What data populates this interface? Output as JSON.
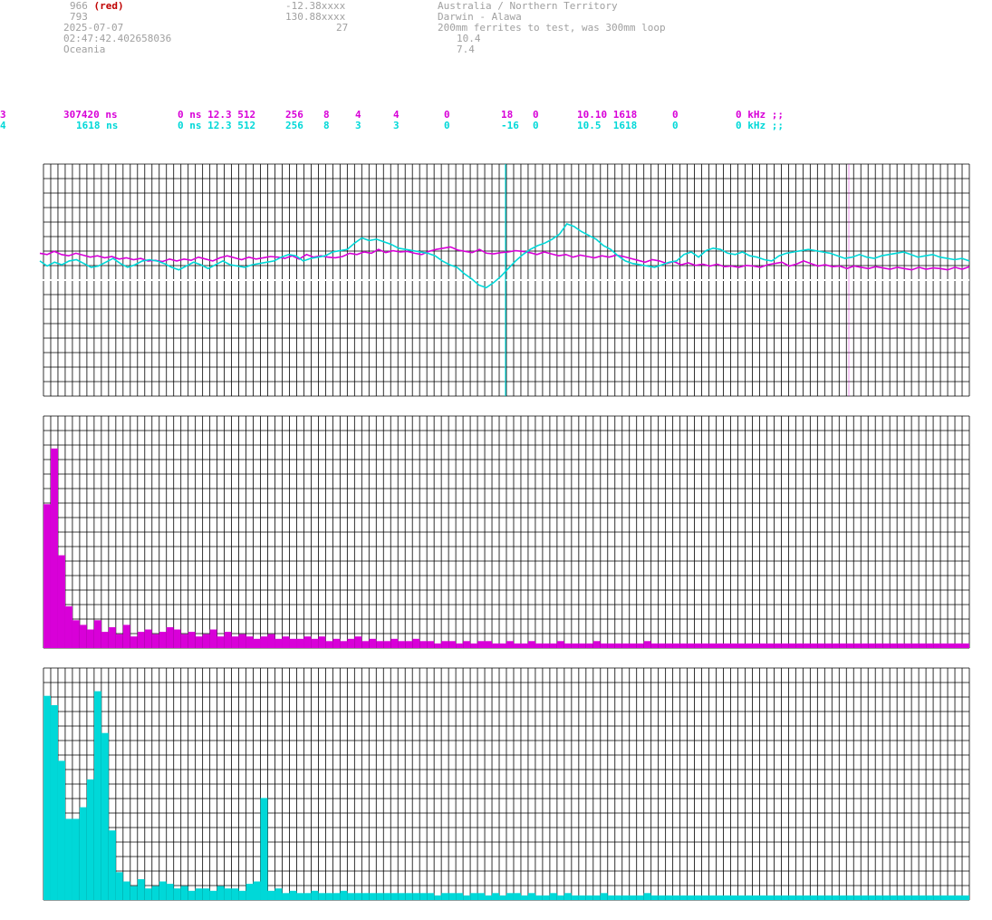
{
  "header": {
    "col1": {
      "line1_num": "966",
      "line1_tag": "(red)",
      "line2": "793",
      "line3": "2025-07-07",
      "line4": "02:47:42.402658036",
      "line5": "Oceania"
    },
    "col2": {
      "line1": "-12.38xxxx",
      "line2": "130.88xxxx",
      "line3": "27"
    },
    "col3": {
      "line1": "Australia / Northern Territory",
      "line2": "Darwin - Alawa",
      "line3": "200mm ferrites to test, was 300mm loop",
      "line4": "10.4",
      "line5": "7.4"
    }
  },
  "channels": [
    {
      "id": "3",
      "f1": "307420 ns",
      "f2": "0 ns 12.3 512",
      "f3": "256",
      "f4": "8",
      "f5": "4",
      "f6": "4",
      "f7": "0",
      "f8": "18",
      "f9": "0",
      "f10": "10.10 1618",
      "f11": "0",
      "f12": "0 kHz ;;"
    },
    {
      "id": "4",
      "f1": "1618 ns",
      "f2": "0 ns 12.3 512",
      "f3": "256",
      "f4": "8",
      "f5": "3",
      "f6": "3",
      "f7": "0",
      "f8": "-16",
      "f9": "0",
      "f10": "10.5  1618",
      "f11": "0",
      "f12": "0 kHz ;;"
    }
  ],
  "colors": {
    "ch3": "#d800d8",
    "ch4": "#00d8d8",
    "grid": "#000000",
    "text": "#a0a0a0"
  },
  "chart_data": [
    {
      "type": "line",
      "series": [
        {
          "values": [
            0.42,
            0.4,
            0.45,
            0.4,
            0.38,
            0.42,
            0.39,
            0.36,
            0.38,
            0.35,
            0.37,
            0.33,
            0.35,
            0.32,
            0.34,
            0.3,
            0.31,
            0.29,
            0.33,
            0.3,
            0.33,
            0.31,
            0.36,
            0.33,
            0.3,
            0.35,
            0.38,
            0.35,
            0.32,
            0.36,
            0.33,
            0.35,
            0.37,
            0.36,
            0.34,
            0.38,
            0.33,
            0.4,
            0.36,
            0.38,
            0.36,
            0.35,
            0.37,
            0.42,
            0.4,
            0.44,
            0.42,
            0.48,
            0.43,
            0.46,
            0.44,
            0.45,
            0.42,
            0.4,
            0.45,
            0.48,
            0.5,
            0.52,
            0.47,
            0.45,
            0.43,
            0.48,
            0.42,
            0.41,
            0.43,
            0.44,
            0.46,
            0.45,
            0.43,
            0.4,
            0.44,
            0.41,
            0.38,
            0.4,
            0.36,
            0.39,
            0.37,
            0.35,
            0.38,
            0.36,
            0.39,
            0.37,
            0.34,
            0.31,
            0.28,
            0.32,
            0.3,
            0.26,
            0.29,
            0.24,
            0.27,
            0.23,
            0.25,
            0.22,
            0.25,
            0.21,
            0.22,
            0.2,
            0.23,
            0.22,
            0.2,
            0.24,
            0.26,
            0.28,
            0.22,
            0.25,
            0.3,
            0.26,
            0.22,
            0.24,
            0.21,
            0.22,
            0.18,
            0.22,
            0.2,
            0.18,
            0.21,
            0.19,
            0.17,
            0.2,
            0.18,
            0.16,
            0.2,
            0.17,
            0.19,
            0.18,
            0.16,
            0.2,
            0.17,
            0.21
          ]
        },
        {
          "values": [
            0.3,
            0.22,
            0.28,
            0.24,
            0.3,
            0.32,
            0.26,
            0.2,
            0.22,
            0.28,
            0.34,
            0.26,
            0.2,
            0.24,
            0.3,
            0.32,
            0.3,
            0.26,
            0.2,
            0.16,
            0.22,
            0.28,
            0.24,
            0.18,
            0.24,
            0.3,
            0.24,
            0.22,
            0.2,
            0.24,
            0.26,
            0.28,
            0.3,
            0.36,
            0.4,
            0.38,
            0.3,
            0.34,
            0.36,
            0.38,
            0.44,
            0.46,
            0.48,
            0.58,
            0.66,
            0.62,
            0.64,
            0.6,
            0.56,
            0.5,
            0.48,
            0.46,
            0.44,
            0.42,
            0.38,
            0.3,
            0.24,
            0.2,
            0.1,
            0.02,
            -0.08,
            -0.12,
            -0.04,
            0.06,
            0.18,
            0.3,
            0.4,
            0.48,
            0.54,
            0.58,
            0.64,
            0.72,
            0.88,
            0.84,
            0.76,
            0.7,
            0.64,
            0.54,
            0.48,
            0.38,
            0.3,
            0.26,
            0.24,
            0.22,
            0.2,
            0.24,
            0.28,
            0.3,
            0.4,
            0.44,
            0.36,
            0.46,
            0.5,
            0.48,
            0.42,
            0.4,
            0.44,
            0.38,
            0.36,
            0.32,
            0.3,
            0.38,
            0.42,
            0.44,
            0.46,
            0.48,
            0.46,
            0.44,
            0.42,
            0.38,
            0.34,
            0.36,
            0.4,
            0.36,
            0.34,
            0.38,
            0.4,
            0.42,
            0.44,
            0.4,
            0.36,
            0.38,
            0.4,
            0.36,
            0.34,
            0.32,
            0.34,
            0.3
          ]
        }
      ]
    },
    {
      "type": "bar",
      "series": [
        {
          "values": [
            62,
            86,
            40,
            18,
            12,
            10,
            8,
            12,
            7,
            9,
            6,
            10,
            5,
            7,
            8,
            6,
            7,
            9,
            8,
            6,
            7,
            5,
            6,
            8,
            5,
            7,
            5,
            6,
            5,
            4,
            5,
            6,
            4,
            5,
            4,
            4,
            5,
            4,
            5,
            3,
            4,
            3,
            4,
            5,
            3,
            4,
            3,
            3,
            4,
            3,
            3,
            4,
            3,
            3,
            2,
            3,
            3,
            2,
            3,
            2,
            3,
            3,
            2,
            2,
            3,
            2,
            2,
            3,
            2,
            2,
            2,
            3,
            2,
            2,
            2,
            2,
            3,
            2,
            2,
            2,
            2,
            2,
            2,
            3,
            2,
            2,
            2,
            2,
            2,
            2,
            2,
            2,
            2,
            2,
            2,
            2,
            2,
            2,
            2,
            2,
            2,
            2,
            2,
            2,
            2,
            2,
            2,
            2,
            2,
            2,
            2,
            2,
            2,
            2,
            2,
            2,
            2,
            2,
            2,
            2,
            2,
            2,
            2,
            2,
            2,
            2,
            2,
            2
          ]
        }
      ]
    },
    {
      "type": "bar",
      "series": [
        {
          "values": [
            88,
            84,
            60,
            35,
            35,
            40,
            52,
            90,
            72,
            30,
            12,
            8,
            6,
            9,
            5,
            6,
            8,
            7,
            5,
            6,
            4,
            5,
            5,
            4,
            6,
            5,
            5,
            4,
            7,
            8,
            44,
            4,
            5,
            3,
            4,
            3,
            3,
            4,
            3,
            3,
            3,
            4,
            3,
            3,
            3,
            3,
            3,
            3,
            3,
            3,
            3,
            3,
            3,
            3,
            2,
            3,
            3,
            3,
            2,
            3,
            3,
            2,
            3,
            2,
            3,
            3,
            2,
            3,
            2,
            2,
            3,
            2,
            3,
            2,
            2,
            2,
            2,
            3,
            2,
            2,
            2,
            2,
            2,
            3,
            2,
            2,
            2,
            2,
            2,
            2,
            2,
            2,
            2,
            2,
            2,
            2,
            2,
            2,
            2,
            2,
            2,
            2,
            2,
            2,
            2,
            2,
            2,
            2,
            2,
            2,
            2,
            2,
            2,
            2,
            2,
            2,
            2,
            2,
            2,
            2,
            2,
            2,
            2,
            2,
            2,
            2,
            2,
            2
          ]
        }
      ]
    }
  ]
}
